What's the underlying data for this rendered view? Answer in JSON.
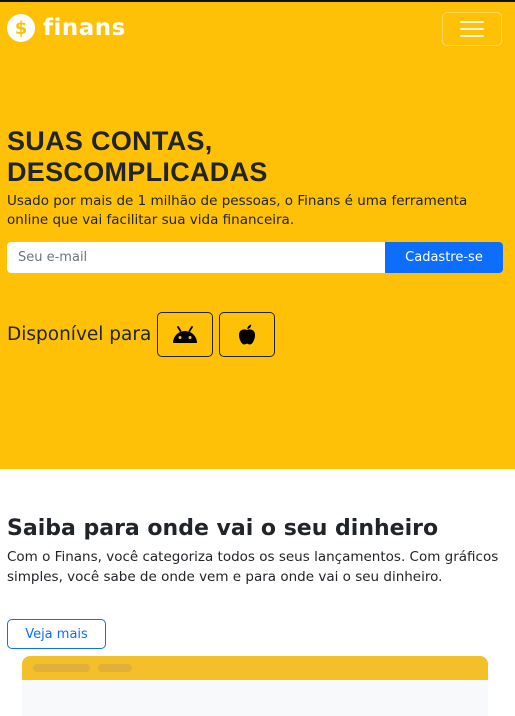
{
  "colors": {
    "brand": "#ffc107",
    "primary": "#0d6efd",
    "text": "#212529"
  },
  "navbar": {
    "brand_icon": "dollar-icon",
    "brand_symbol": "$",
    "brand_name": "finans",
    "toggler_icon": "hamburger-menu-icon"
  },
  "hero": {
    "title_line1": "SUAS CONTAS,",
    "title_line2": "DESCOMPLICADAS",
    "subtitle": "Usado por mais de 1 milhão de pessoas, o Finans é uma ferramenta online que vai facilitar sua vida financeira.",
    "email_placeholder": "Seu e-mail",
    "email_value": "",
    "signup_button": "Cadastre-se",
    "available_label": "Disponível para",
    "stores": [
      {
        "icon": "android-icon"
      },
      {
        "icon": "apple-icon"
      }
    ]
  },
  "features": {
    "title": "Saiba para onde vai o seu dinheiro",
    "text": "Com o Finans, você categoriza todos os seus lançamentos. Com gráficos simples, você sabe de onde vem e para onde vai o seu dinheiro.",
    "more_button": "Veja mais"
  }
}
